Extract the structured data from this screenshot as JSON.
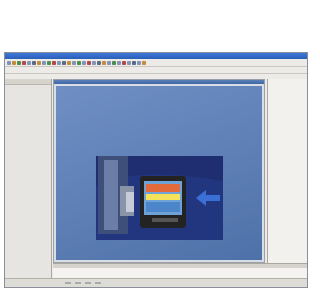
{
  "window": {
    "title": ""
  },
  "menu": {
    "items": [
      "",
      "",
      "",
      "",
      "",
      "",
      "",
      "",
      "",
      "",
      ""
    ]
  },
  "toolbar": {
    "buttons": 28
  },
  "right_panel": {
    "rows": [
      {
        "label": "",
        "value": ""
      },
      {
        "label": "",
        "value": ""
      },
      {
        "label": "",
        "value": ""
      },
      {
        "label": "",
        "value": ""
      },
      {
        "label": "",
        "value": ""
      },
      {
        "label": "",
        "value": ""
      },
      {
        "label": "",
        "value": ""
      },
      {
        "label": "",
        "value": ""
      }
    ]
  },
  "statusbar": {
    "items": [
      "",
      "",
      "",
      ""
    ]
  },
  "colors": {
    "canvas_blue": "#5d7fb6",
    "illustration_blue": "#1d2b6b",
    "title_blue": "#2a5fb9",
    "arrow_blue": "#3a6fd6"
  }
}
